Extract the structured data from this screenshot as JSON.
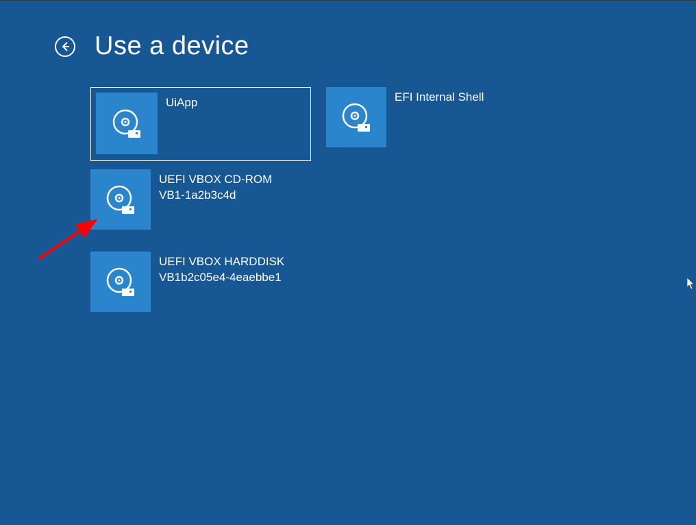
{
  "header": {
    "title": "Use a device"
  },
  "devices": [
    {
      "label": "UiApp",
      "label2": "",
      "selected": true
    },
    {
      "label": "EFI Internal Shell",
      "label2": "",
      "selected": false
    },
    {
      "label": "UEFI VBOX CD-ROM",
      "label2": "VB1-1a2b3c4d",
      "selected": false
    },
    {
      "label": "",
      "label2": "",
      "selected": false,
      "empty": true
    },
    {
      "label": "UEFI VBOX HARDDISK",
      "label2": "VB1b2c05e4-4eaebbe1",
      "selected": false
    }
  ],
  "colors": {
    "background": "#175794",
    "tile": "#2b85cc",
    "annotation": "#ff0000"
  }
}
